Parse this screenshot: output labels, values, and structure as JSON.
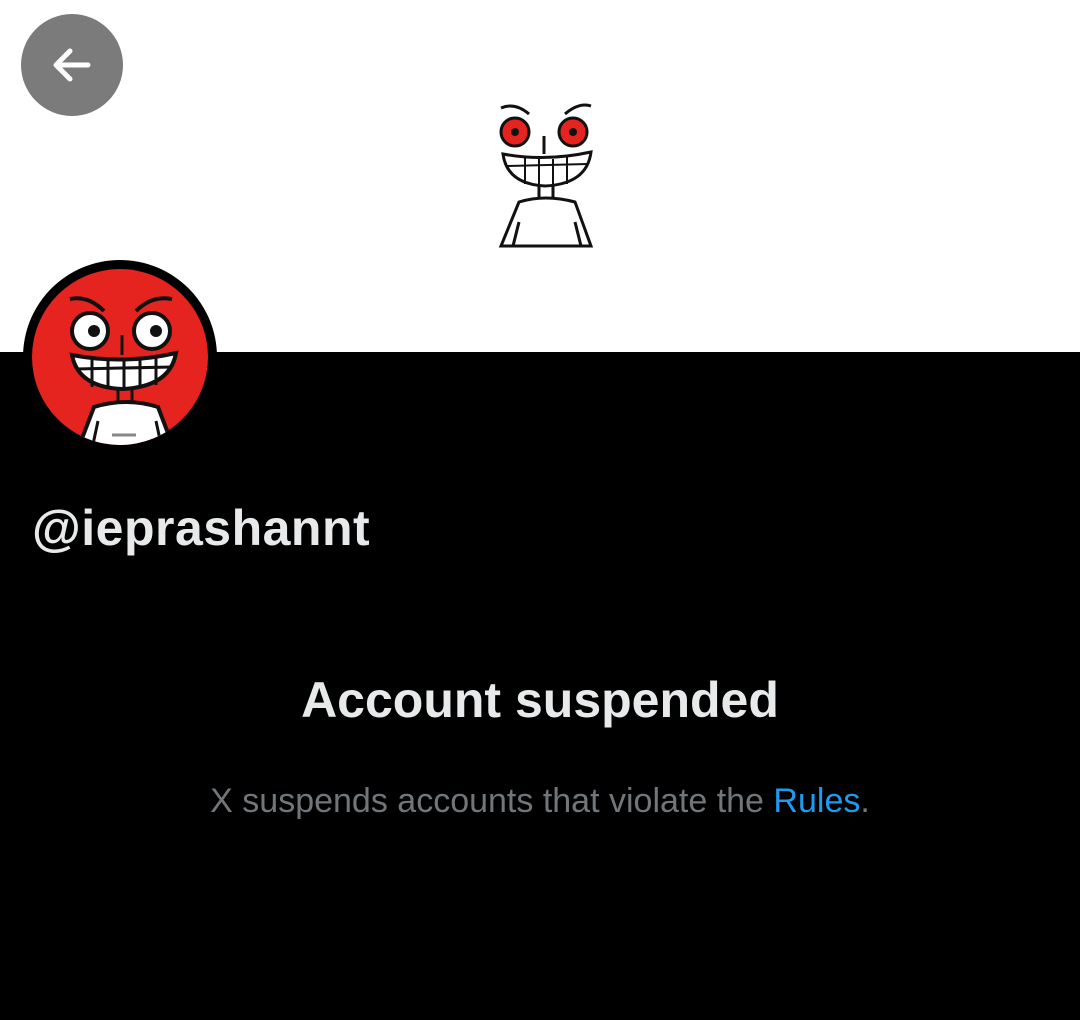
{
  "header": {
    "back_icon": "arrow-left-icon",
    "back_button_color": "#7b7b7b"
  },
  "profile": {
    "handle": "@ieprashannt",
    "avatar_color": "#e5231f"
  },
  "notice": {
    "title": "Account suspended",
    "message_prefix": "X suspends accounts that violate the ",
    "rules_link": "Rules",
    "message_suffix": ".",
    "link_color": "#1d9bf0"
  }
}
